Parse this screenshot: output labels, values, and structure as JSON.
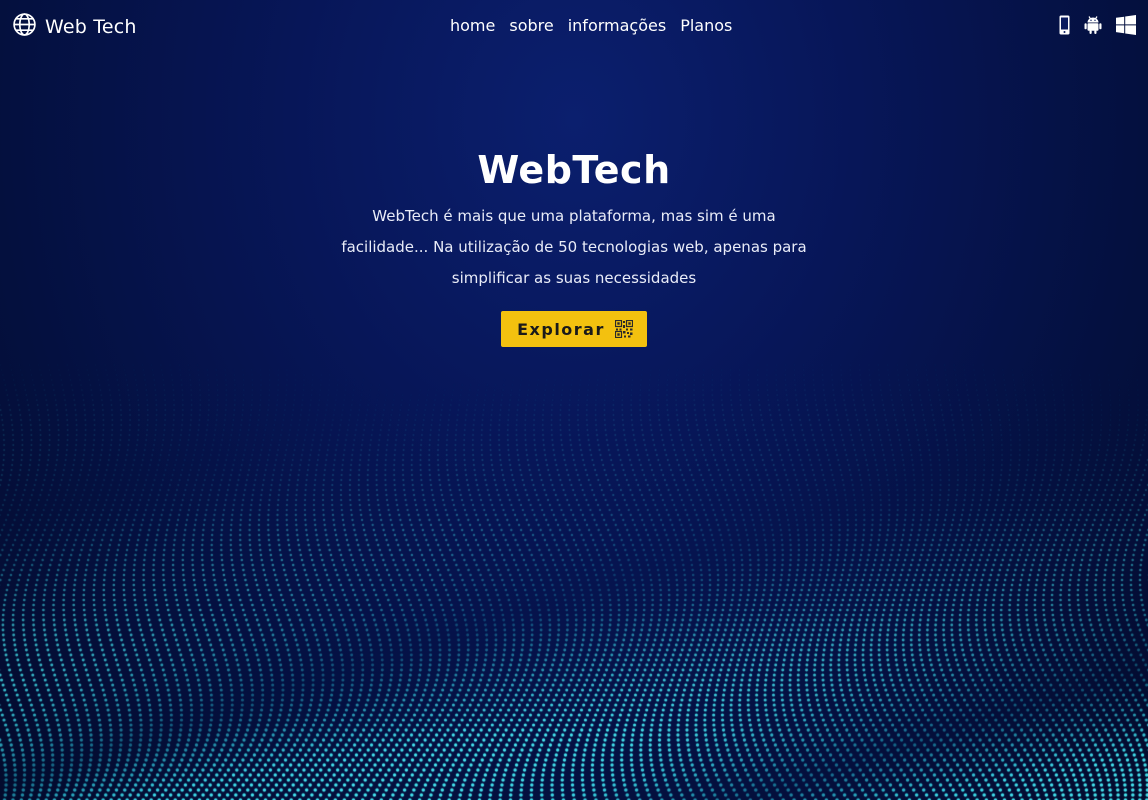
{
  "header": {
    "logo_text": "Web Tech",
    "nav": [
      {
        "label": "home"
      },
      {
        "label": "sobre"
      },
      {
        "label": "informações"
      },
      {
        "label": "Planos"
      }
    ],
    "platform_icons": [
      "mobile-phone-icon",
      "android-icon",
      "windows-icon"
    ]
  },
  "hero": {
    "title": "WebTech",
    "description": "WebTech é mais que uma plataforma, mas sim é uma facilidade... Na utilização de 50 tecnologias web, apenas para simplificar as suas necessidades",
    "button_label": "Explorar",
    "button_icon": "qr-code-icon"
  },
  "colors": {
    "background": "#071658",
    "accent_button": "#f3c10f",
    "particle_wave": "#3fd8e8",
    "text": "#ffffff"
  }
}
